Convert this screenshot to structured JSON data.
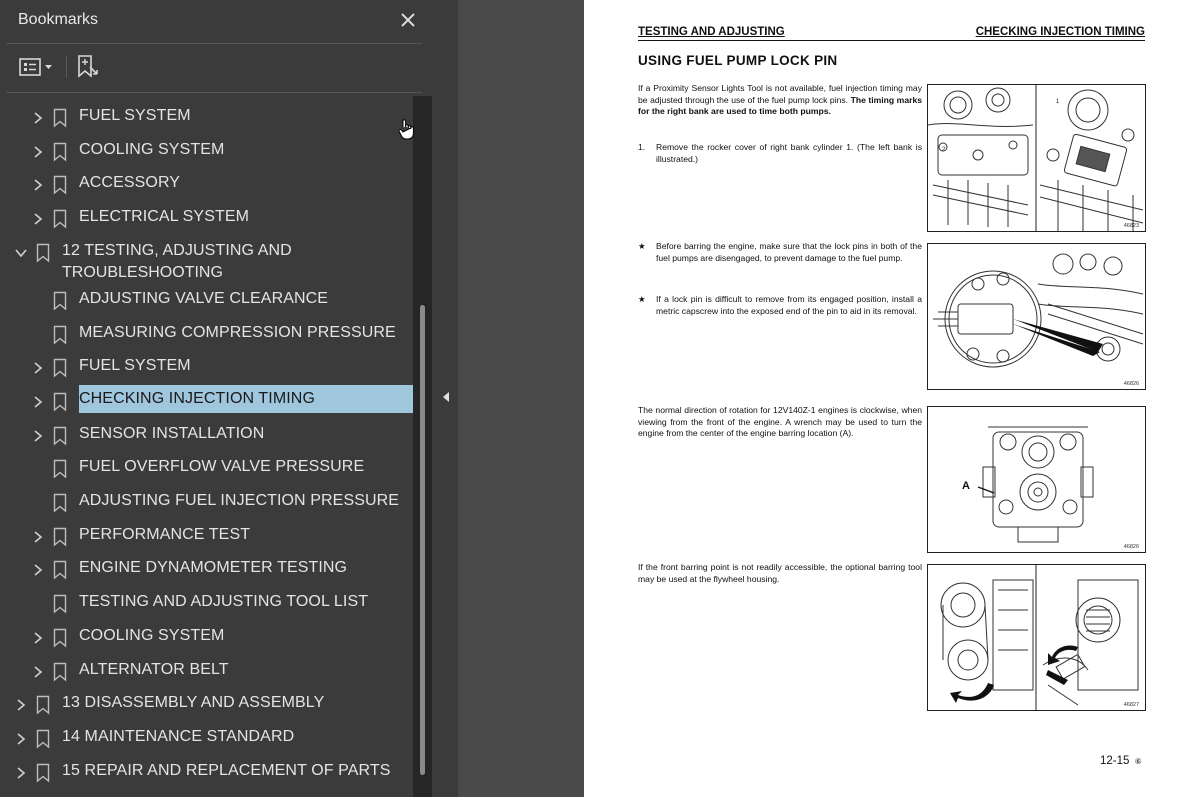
{
  "panel": {
    "title": "Bookmarks",
    "icons": {
      "close": "close-icon",
      "options": "options-menu-icon",
      "add": "add-bookmark-icon"
    }
  },
  "bookmarks": [
    {
      "label": "FUEL SYSTEM",
      "level": 1,
      "expander": "collapsed"
    },
    {
      "label": "COOLING SYSTEM",
      "level": 1,
      "expander": "collapsed"
    },
    {
      "label": "ACCESSORY",
      "level": 1,
      "expander": "collapsed"
    },
    {
      "label": "ELECTRICAL SYSTEM",
      "level": 1,
      "expander": "collapsed"
    },
    {
      "label": "12  TESTING, ADJUSTING AND",
      "label2": "TROUBLESHOOTING",
      "level": 0,
      "expander": "expanded"
    },
    {
      "label": "ADJUSTING VALVE CLEARANCE",
      "level": 1,
      "expander": "none"
    },
    {
      "label": "MEASURING COMPRESSION PRESSURE",
      "level": 1,
      "expander": "none"
    },
    {
      "label": "FUEL SYSTEM",
      "level": 1,
      "expander": "collapsed"
    },
    {
      "label": "CHECKING INJECTION TIMING",
      "level": 1,
      "expander": "collapsed",
      "selected": true
    },
    {
      "label": "SENSOR INSTALLATION",
      "level": 1,
      "expander": "collapsed"
    },
    {
      "label": "FUEL OVERFLOW VALVE PRESSURE",
      "level": 1,
      "expander": "none"
    },
    {
      "label": "ADJUSTING FUEL INJECTION PRESSURE",
      "level": 1,
      "expander": "none"
    },
    {
      "label": "PERFORMANCE TEST",
      "level": 1,
      "expander": "collapsed"
    },
    {
      "label": "ENGINE DYNAMOMETER TESTING",
      "level": 1,
      "expander": "collapsed"
    },
    {
      "label": "TESTING AND ADJUSTING TOOL LIST",
      "level": 1,
      "expander": "none"
    },
    {
      "label": "COOLING SYSTEM",
      "level": 1,
      "expander": "collapsed"
    },
    {
      "label": "ALTERNATOR BELT",
      "level": 1,
      "expander": "collapsed"
    },
    {
      "label": "13  DISASSEMBLY AND ASSEMBLY",
      "level": 0,
      "expander": "collapsed"
    },
    {
      "label": "14  MAINTENANCE STANDARD",
      "level": 0,
      "expander": "collapsed"
    },
    {
      "label": "15 REPAIR AND REPLACEMENT OF PARTS",
      "level": 0,
      "expander": "collapsed"
    }
  ],
  "colors": {
    "selected_bg": "#9fc6dc",
    "panel_bg": "#3b3b3b",
    "page_bg": "#ffffff"
  },
  "page": {
    "header_left": "TESTING AND ADJUSTING",
    "header_right": "CHECKING INJECTION TIMING",
    "section_title": "USING FUEL PUMP LOCK PIN",
    "para1": "If a Proximity Sensor Lights Tool is not available, fuel injection timing may be adjusted through the use of the fuel pump lock pins.",
    "para1_bold": "The timing marks for the right bank are used to time both pumps.",
    "step1_num": "1.",
    "step1": "Remove the rocker cover of right bank cylinder 1. (The left bank is illustrated.)",
    "star": "★",
    "note1": "Before barring the engine, make sure that the lock pins in both of the fuel pumps are disengaged, to prevent damage to the fuel pump.",
    "note2": "If a lock pin is difficult to remove from its engaged position, install a metric capscrew into the exposed end of the pin to aid in its removal.",
    "para2": "The normal direction of rotation for 12V140Z-1 engines is clockwise, when viewing from the front of the engine. A wrench may be used to turn the engine from the center of the engine barring location (A).",
    "para3": "If the front barring point is not readily accessible, the optional barring tool may be used at the flywheel housing.",
    "figures": [
      {
        "number": "46823"
      },
      {
        "number": "46826"
      },
      {
        "number": "46826",
        "callout": "A"
      },
      {
        "number": "46827"
      }
    ],
    "page_number": "12-15",
    "page_mark": "⑥"
  }
}
